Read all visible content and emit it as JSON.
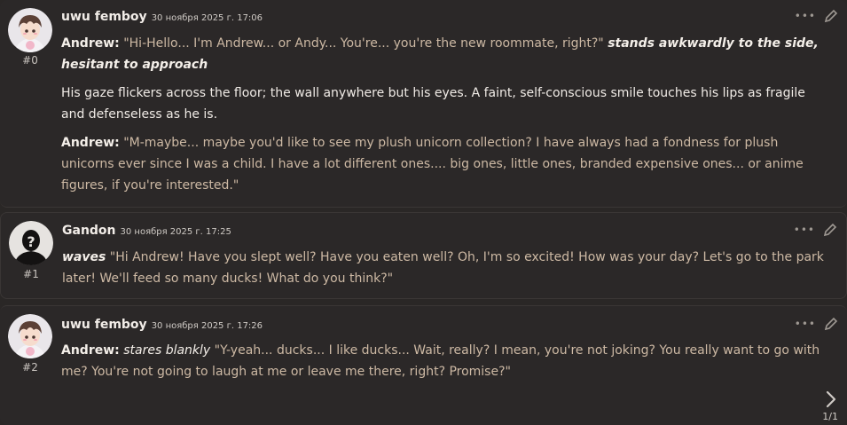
{
  "messages": [
    {
      "author": "uwu femboy",
      "timestamp": "30 ноября 2025 г. 17:06",
      "index": "#0",
      "paragraphs": {
        "p1": {
          "speaker": "Andrew:",
          "quote": "\"Hi-Hello... I'm Andrew... or Andy... You're... you're the new roommate, right?\"",
          "action": "stands awkwardly to the side, hesitant to approach"
        },
        "p2": {
          "text": "His gaze flickers across the floor; the wall anywhere but his eyes. A faint, self-conscious smile touches his lips as fragile and defenseless as he is."
        },
        "p3": {
          "speaker": "Andrew:",
          "quote": "\"M-maybe... maybe you'd like to see my plush unicorn collection? I have always had a fondness for plush unicorns ever since I was a child. I have a lot different ones.... big ones, little ones, branded expensive ones... or anime figures, if you're interested.\""
        }
      }
    },
    {
      "author": "Gandon",
      "timestamp": "30 ноября 2025 г. 17:25",
      "index": "#1",
      "paragraphs": {
        "p1": {
          "action": "waves",
          "quote": "\"Hi Andrew! Have you slept well? Have you eaten well? Oh, I'm so excited! How was your day? Let's go to the park later! We'll feed so many ducks! What do you think?\""
        }
      }
    },
    {
      "author": "uwu femboy",
      "timestamp": "30 ноября 2025 г. 17:26",
      "index": "#2",
      "paragraphs": {
        "p1": {
          "speaker": "Andrew:",
          "action": "stares blankly",
          "quote": "\"Y-yeah... ducks... I like ducks... Wait, really? I mean, you're not joking? You really want to go with me? You're not going to laugh at me or leave me there, right? Promise?\""
        }
      }
    }
  ],
  "pager": {
    "label": "1/1"
  },
  "icons": {
    "more": "ellipsis-icon",
    "edit": "pencil-icon",
    "next": "chevron-right-icon"
  },
  "colors": {
    "quote": "#cdb9a4",
    "background": "#2a2726"
  }
}
